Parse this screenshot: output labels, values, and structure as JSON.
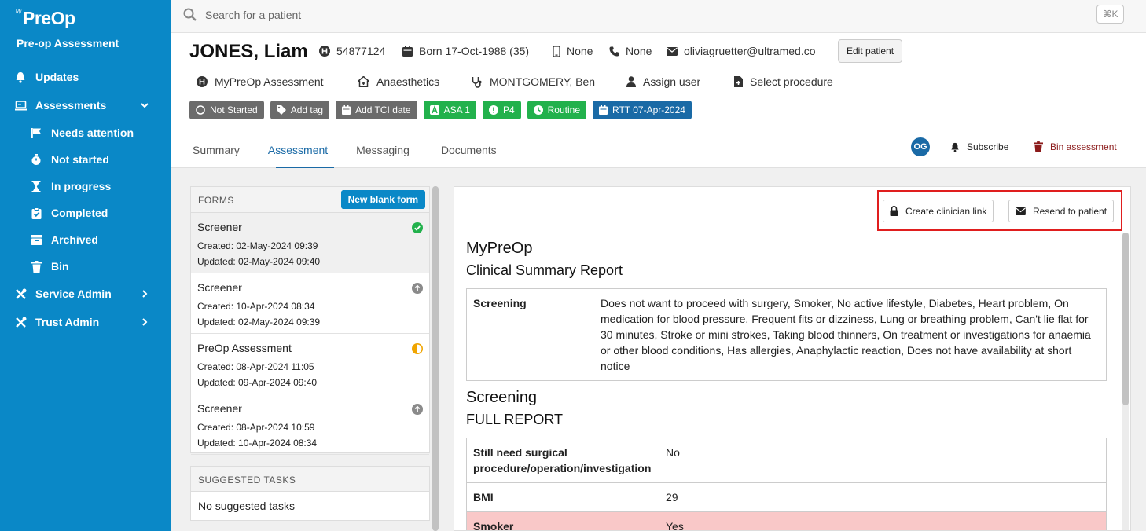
{
  "sidebar": {
    "logo": "PreOp",
    "logo_sup": "My",
    "app_subtitle": "Pre-op Assessment",
    "nav": {
      "updates": "Updates",
      "assessments": "Assessments",
      "needs_attention": "Needs attention",
      "not_started": "Not started",
      "in_progress": "In progress",
      "completed": "Completed",
      "archived": "Archived",
      "bin": "Bin",
      "service_admin": "Service Admin",
      "trust_admin": "Trust Admin"
    }
  },
  "search": {
    "placeholder": "Search for a patient",
    "shortcut": "⌘K"
  },
  "patient": {
    "name": "JONES, Liam",
    "hospital_number": "54877124",
    "born": "Born 17-Oct-1988 (35)",
    "mobile": "None",
    "phone": "None",
    "email": "oliviagruetter@ultramed.co",
    "edit_label": "Edit patient",
    "assessment_type": "MyPreOp Assessment",
    "department": "Anaesthetics",
    "clinician": "MONTGOMERY, Ben",
    "assign_user": "Assign user",
    "select_procedure": "Select procedure"
  },
  "tags": {
    "not_started": "Not Started",
    "add_tag": "Add tag",
    "add_tci": "Add TCI date",
    "asa": "ASA 1",
    "priority": "P4",
    "routine": "Routine",
    "rtt": "RTT 07-Apr-2024"
  },
  "colors": {
    "brand": "#0a88c7",
    "tag_green": "#22b14c",
    "tag_blue": "#1a6aa6",
    "tag_grey": "#6b6b6b",
    "danger": "#8b1a1a",
    "highlight": "#e01e1e",
    "row_alert": "#f9c8c8"
  },
  "tabs": [
    "Summary",
    "Assessment",
    "Messaging",
    "Documents"
  ],
  "actions": {
    "avatar_initials": "OG",
    "subscribe": "Subscribe",
    "bin_assessment": "Bin assessment"
  },
  "forms": {
    "title": "FORMS",
    "new_blank": "New blank form",
    "items": [
      {
        "name": "Screener",
        "created": "Created: 02-May-2024 09:39",
        "updated": "Updated: 02-May-2024 09:40",
        "status": "completed"
      },
      {
        "name": "Screener",
        "created": "Created: 10-Apr-2024 08:34",
        "updated": "Updated: 02-May-2024 09:39",
        "status": "submitted"
      },
      {
        "name": "PreOp Assessment",
        "created": "Created: 08-Apr-2024 11:05",
        "updated": "Updated: 09-Apr-2024 09:40",
        "status": "in-progress"
      },
      {
        "name": "Screener",
        "created": "Created: 08-Apr-2024 10:59",
        "updated": "Updated: 10-Apr-2024 08:34",
        "status": "submitted"
      }
    ]
  },
  "suggested_tasks": {
    "title": "SUGGESTED TASKS",
    "empty": "No suggested tasks"
  },
  "report": {
    "create_link": "Create clinician link",
    "resend": "Resend to patient",
    "title": "MyPreOp",
    "subtitle": "Clinical Summary Report",
    "summary_rows": [
      {
        "key": "Screening",
        "value": "Does not want to proceed with surgery, Smoker, No active lifestyle, Diabetes, Heart problem, On medication for blood pressure, Frequent fits or dizziness, Lung or breathing problem, Can't lie flat for 30 minutes, Stroke or mini strokes, Taking blood thinners, On treatment or investigations for anaemia or other blood conditions, Has allergies, Anaphylactic reaction, Does not have availability at short notice"
      }
    ],
    "section_title": "Screening",
    "section_subtitle": "FULL REPORT",
    "full_rows": [
      {
        "key": "Still need surgical procedure/operation/investigation",
        "value": "No"
      },
      {
        "key": "BMI",
        "value": "29"
      },
      {
        "key": "Smoker",
        "value": "Yes"
      }
    ]
  }
}
